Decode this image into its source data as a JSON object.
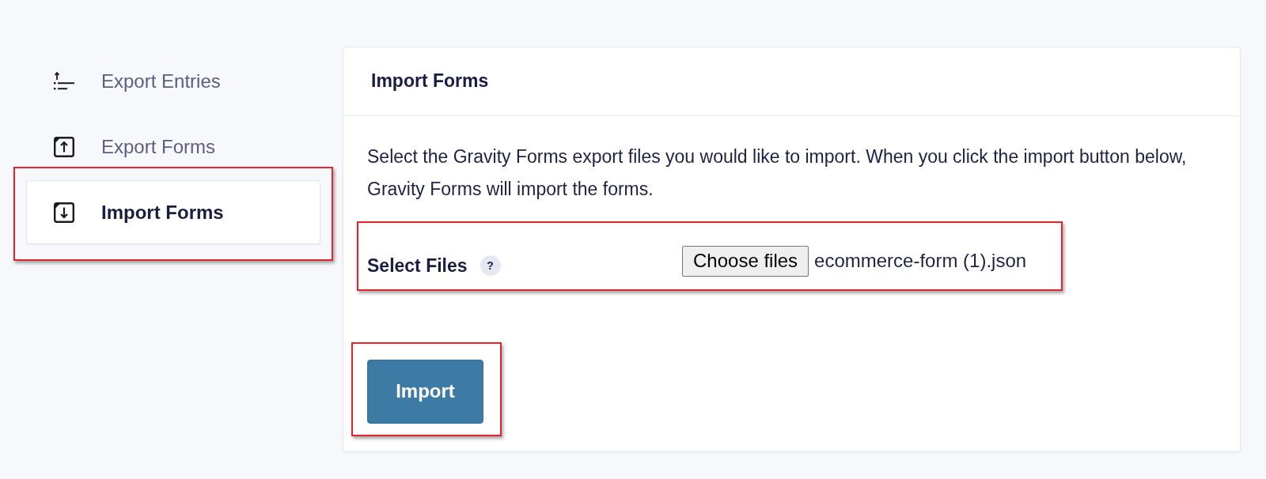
{
  "sidebar": {
    "items": [
      {
        "label": "Export Entries",
        "selected": false,
        "highlighted": false
      },
      {
        "label": "Export Forms",
        "selected": false,
        "highlighted": false
      },
      {
        "label": "Import Forms",
        "selected": true,
        "highlighted": true
      }
    ]
  },
  "panel": {
    "title": "Import Forms",
    "description": "Select the Gravity Forms export files you would like to import. When you click the import button below, Gravity Forms will import the forms.",
    "file_field": {
      "label": "Select Files",
      "help": "?",
      "button": "Choose files",
      "value": "ecommerce-form (1).json",
      "highlighted": true
    },
    "import_button": {
      "label": "Import",
      "highlighted": true
    }
  }
}
